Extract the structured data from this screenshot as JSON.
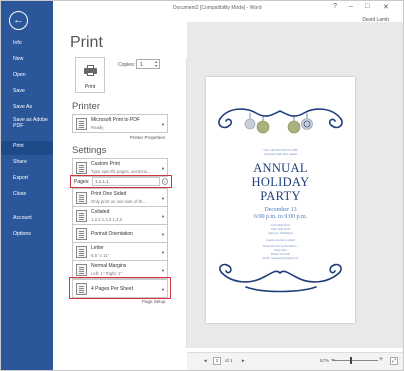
{
  "window": {
    "title": "Document2 [Compatibility Mode] - Word",
    "user": "David Lamb",
    "controls": [
      "?",
      "–",
      "□",
      "✕"
    ]
  },
  "sidebar": {
    "back_glyph": "←",
    "items": [
      {
        "label": "Info"
      },
      {
        "label": "New"
      },
      {
        "label": "Open"
      },
      {
        "label": "Save"
      },
      {
        "label": "Save As"
      },
      {
        "label": "Save as Adobe PDF"
      },
      {
        "label": "Print",
        "active": true
      },
      {
        "label": "Share"
      },
      {
        "label": "Export"
      },
      {
        "label": "Close"
      },
      {
        "label": "Account"
      },
      {
        "label": "Options"
      }
    ]
  },
  "print": {
    "title": "Print",
    "button_label": "Print",
    "copies_label": "Copies:",
    "copies_value": "1"
  },
  "printer": {
    "heading": "Printer",
    "name": "Microsoft Print to PDF",
    "status": "Ready",
    "properties_link": "Printer Properties"
  },
  "settings": {
    "heading": "Settings",
    "items": [
      {
        "line1": "Custom Print",
        "line2": "Type specific pages, sections..."
      },
      {
        "line1": "Print One Sided",
        "line2": "Only print on one side of th..."
      },
      {
        "line1": "Collated",
        "line2": "1,2,3    1,2,3    1,2,3"
      },
      {
        "line1": "Portrait Orientation",
        "line2": ""
      },
      {
        "line1": "Letter",
        "line2": "8.5\" x 11\""
      },
      {
        "line1": "Normal Margins",
        "line2": "Left: 1\"   Right: 1\""
      },
      {
        "line1": "4 Pages Per Sheet",
        "line2": ""
      }
    ],
    "pages_label": "Pages:",
    "pages_value": "1,1,1,1",
    "page_setup_link": "Page Setup"
  },
  "preview": {
    "small_top_1": "YOU ARE INVITED TO THE",
    "small_top_2": "Company Name Here Annual",
    "title_1": "ANNUAL",
    "title_2": "HOLIDAY",
    "title_3": "PARTY",
    "date_1": "December 13",
    "date_2": "6:00 p.m. to 9:00 p.m.",
    "address_1": "1234 Main Street",
    "address_2": "Suite 1000 North",
    "address_3": "Anytown, Washington",
    "rsvp_1": "Guests welcome to attend",
    "rsvp_2": "Please R.S.V.P. by December 1",
    "rsvp_3": "Name Here",
    "rsvp_4": "Phone: 555-0100",
    "rsvp_5": "Email: someone@example.com",
    "colors": {
      "navy": "#1f3e7a",
      "blue": "#4a7bb9",
      "olive": "#a9b27c",
      "silver": "#c9cfd6"
    }
  },
  "status": {
    "prev": "◄",
    "page": "1",
    "of": "of 1",
    "next": "►",
    "zoom": "57%",
    "zoom_out": "–",
    "zoom_in": "+",
    "zoom_fraction": 0.42
  },
  "colors": {
    "sidebar_bg": "#2b579a",
    "highlight_red": "#d0353b"
  }
}
